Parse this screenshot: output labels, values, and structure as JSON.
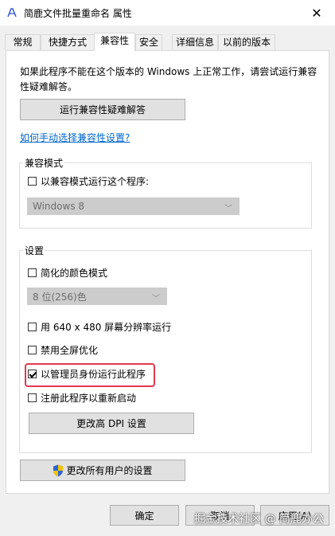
{
  "window": {
    "title": "简鹿文件批量重命名 属性",
    "close_glyph": "✕"
  },
  "tabs": [
    {
      "label": "常规"
    },
    {
      "label": "快捷方式"
    },
    {
      "label": "兼容性"
    },
    {
      "label": "安全"
    },
    {
      "label": "详细信息"
    },
    {
      "label": "以前的版本"
    }
  ],
  "compat": {
    "description": "如果此程序不能在这个版本的 Windows 上正常工作，请尝试运行兼容性疑难解答。",
    "troubleshooter_button": "运行兼容性疑难解答",
    "manual_link": "如何手动选择兼容性设置?",
    "mode_group": {
      "legend": "兼容模式",
      "checkbox": "以兼容模式运行这个程序:",
      "checked": false,
      "select_value": "Windows 8"
    },
    "settings_group": {
      "legend": "设置",
      "reduced_color": {
        "label": "简化的颜色模式",
        "checked": false
      },
      "color_select_value": "8 位(256)色",
      "res_640": {
        "label": "用 640 x 480 屏幕分辨率运行",
        "checked": false
      },
      "disable_fullscreen": {
        "label": "禁用全屏优化",
        "checked": false
      },
      "run_as_admin": {
        "label": "以管理员身份运行此程序",
        "checked": true
      },
      "register_restart": {
        "label": "注册此程序以重新启动",
        "checked": false
      },
      "dpi_button": "更改高 DPI 设置"
    },
    "all_users_button": "更改所有用户的设置"
  },
  "footer": {
    "ok": "确定",
    "cancel": "取消",
    "apply": "应用(A)"
  },
  "watermark": "掘金技术社区 @ 简鹿办公",
  "colors": {
    "highlight": "#e0394f",
    "link": "#0066cc",
    "shield_blue": "#2b66d9",
    "shield_yellow": "#f5c400"
  }
}
